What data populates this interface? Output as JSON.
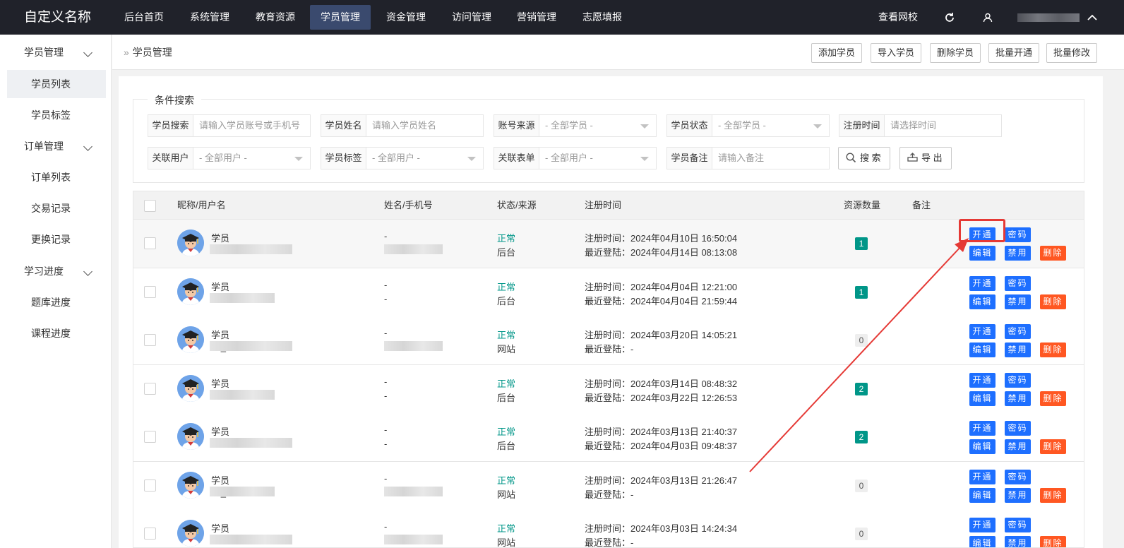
{
  "brand": "自定义名称",
  "nav": [
    "后台首页",
    "系统管理",
    "教育资源",
    "学员管理",
    "资金管理",
    "访问管理",
    "营销管理",
    "志愿填报"
  ],
  "nav_active": "学员管理",
  "top_right": {
    "view_school": "查看网校",
    "refresh_icon": "refresh-icon",
    "user_icon": "user-icon"
  },
  "sidebar": [
    {
      "label": "学员管理",
      "type": "group"
    },
    {
      "label": "学员列表",
      "type": "item",
      "active": true
    },
    {
      "label": "学员标签",
      "type": "item"
    },
    {
      "label": "订单管理",
      "type": "group"
    },
    {
      "label": "订单列表",
      "type": "item"
    },
    {
      "label": "交易记录",
      "type": "item"
    },
    {
      "label": "更换记录",
      "type": "item"
    },
    {
      "label": "学习进度",
      "type": "group"
    },
    {
      "label": "题库进度",
      "type": "item"
    },
    {
      "label": "课程进度",
      "type": "item"
    }
  ],
  "breadcrumb": "学员管理",
  "toolbar": [
    "添加学员",
    "导入学员",
    "删除学员",
    "批量开通",
    "批量修改"
  ],
  "search": {
    "legend": "条件搜索",
    "fields": [
      {
        "label": "学员搜索",
        "placeholder": "请输入学员账号或手机号",
        "select": false
      },
      {
        "label": "学员姓名",
        "placeholder": "请输入学员姓名",
        "select": false
      },
      {
        "label": "账号来源",
        "placeholder": "- 全部学员 -",
        "select": true
      },
      {
        "label": "学员状态",
        "placeholder": "- 全部学员 -",
        "select": true
      },
      {
        "label": "注册时间",
        "placeholder": "请选择时间",
        "select": false
      },
      {
        "label": "关联用户",
        "placeholder": "- 全部用户 -",
        "select": true
      },
      {
        "label": "学员标签",
        "placeholder": "- 全部用户 -",
        "select": true
      },
      {
        "label": "关联表单",
        "placeholder": "- 全部用户 -",
        "select": true
      },
      {
        "label": "学员备注",
        "placeholder": "请输入备注",
        "select": false
      }
    ],
    "search_btn": "搜 索",
    "export_btn": "导 出"
  },
  "table": {
    "headers": [
      "昵称/用户名",
      "姓名/手机号",
      "状态/来源",
      "注册时间",
      "资源数量",
      "备注"
    ],
    "actions": {
      "open": "开通",
      "password": "密码",
      "edit": "编辑",
      "disable": "禁用",
      "delete": "删除"
    },
    "rows": [
      {
        "nick": "学员",
        "user": "",
        "name": "-",
        "phone": "",
        "status": "正常",
        "source": "后台",
        "reg": "注册时间：2024年04月10日 16:50:04",
        "login": "最近登陆：2024年04月14日 08:13:08",
        "count": "1"
      },
      {
        "nick": "学员",
        "user": "",
        "name": "-",
        "phone": "-",
        "status": "正常",
        "source": "后台",
        "reg": "注册时间：2024年04月04日 12:21:00",
        "login": "最近登陆：2024年04月04日 21:59:44",
        "count": "1"
      },
      {
        "nick": "学员",
        "user": "dk_8100",
        "name": "-",
        "phone": "",
        "status": "正常",
        "source": "网站",
        "reg": "注册时间：2024年03月20日 14:05:21",
        "login": "最近登陆：-",
        "count": "0"
      },
      {
        "nick": "学员",
        "user": "",
        "name": "-",
        "phone": "-",
        "status": "正常",
        "source": "后台",
        "reg": "注册时间：2024年03月14日 08:48:32",
        "login": "最近登陆：2024年03月22日 12:26:53",
        "count": "2"
      },
      {
        "nick": "学员",
        "user": "dk",
        "name": "-",
        "phone": "-",
        "status": "正常",
        "source": "后台",
        "reg": "注册时间：2024年03月13日 21:40:37",
        "login": "最近登陆：2024年04月03日 09:48:37",
        "count": "2"
      },
      {
        "nick": "学员",
        "user": "dk_8",
        "name": "-",
        "phone": "",
        "status": "正常",
        "source": "网站",
        "reg": "注册时间：2024年03月13日 21:26:47",
        "login": "最近登陆：-",
        "count": "0"
      },
      {
        "nick": "学员",
        "user": "",
        "name": "-",
        "phone": "",
        "status": "正常",
        "source": "网站",
        "reg": "注册时间：2024年03月03日 14:24:34",
        "login": "最近登陆：-",
        "count": "0"
      }
    ]
  },
  "colors": {
    "topbar": "#20222a",
    "accent": "#1e6fff",
    "danger": "#ff5722",
    "success": "#009688",
    "annotation": "#e53935"
  }
}
